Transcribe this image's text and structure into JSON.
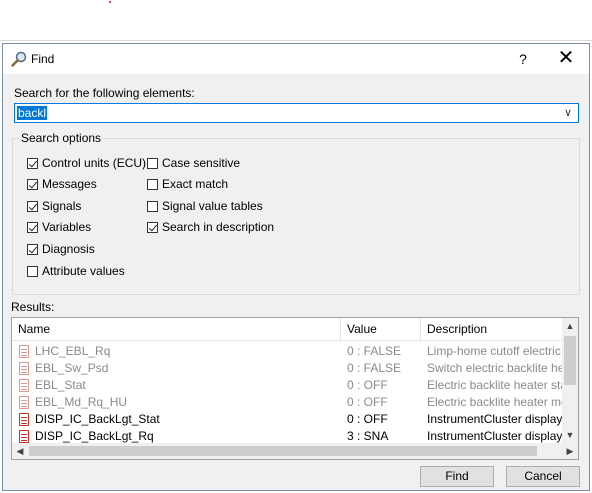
{
  "dialog": {
    "title": "Find",
    "help_label": "?",
    "close_label": "✕"
  },
  "search": {
    "label": "Search for the following elements:",
    "value": "backl"
  },
  "options": {
    "group_label": "Search options",
    "items": [
      {
        "label": "Control units (ECU)",
        "checked": true
      },
      {
        "label": "Messages",
        "checked": true
      },
      {
        "label": "Signals",
        "checked": true
      },
      {
        "label": "Variables",
        "checked": true
      },
      {
        "label": "Diagnosis",
        "checked": true
      },
      {
        "label": "Attribute values",
        "checked": false
      },
      {
        "label": "Case sensitive",
        "checked": false
      },
      {
        "label": "Exact match",
        "checked": false
      },
      {
        "label": "Signal value tables",
        "checked": false
      },
      {
        "label": "Search in description",
        "checked": true
      }
    ]
  },
  "results": {
    "label": "Results:",
    "columns": [
      "Name",
      "Value",
      "Description"
    ],
    "rows": [
      {
        "name": "LHC_EBL_Rq",
        "value": "0 : FALSE",
        "description": "Limp-home cutoff electric bac",
        "dimmed": true
      },
      {
        "name": "EBL_Sw_Psd",
        "value": "0 : FALSE",
        "description": "Switch electric backlite heate",
        "dimmed": true
      },
      {
        "name": "EBL_Stat",
        "value": "0 : OFF",
        "description": "Electric backlite heater state",
        "dimmed": true
      },
      {
        "name": "EBL_Md_Rq_HU",
        "value": "0 : OFF",
        "description": "Electric backlite heater mode",
        "dimmed": true
      },
      {
        "name": "DISP_IC_BackLgt_Stat",
        "value": "0 : OFF",
        "description": "InstrumentCluster display bac",
        "dimmed": false
      },
      {
        "name": "DISP_IC_BackLgt_Rq",
        "value": "3 : SNA",
        "description": "InstrumentCluster display bac",
        "dimmed": false
      }
    ]
  },
  "buttons": {
    "find": "Find",
    "cancel": "Cancel"
  }
}
